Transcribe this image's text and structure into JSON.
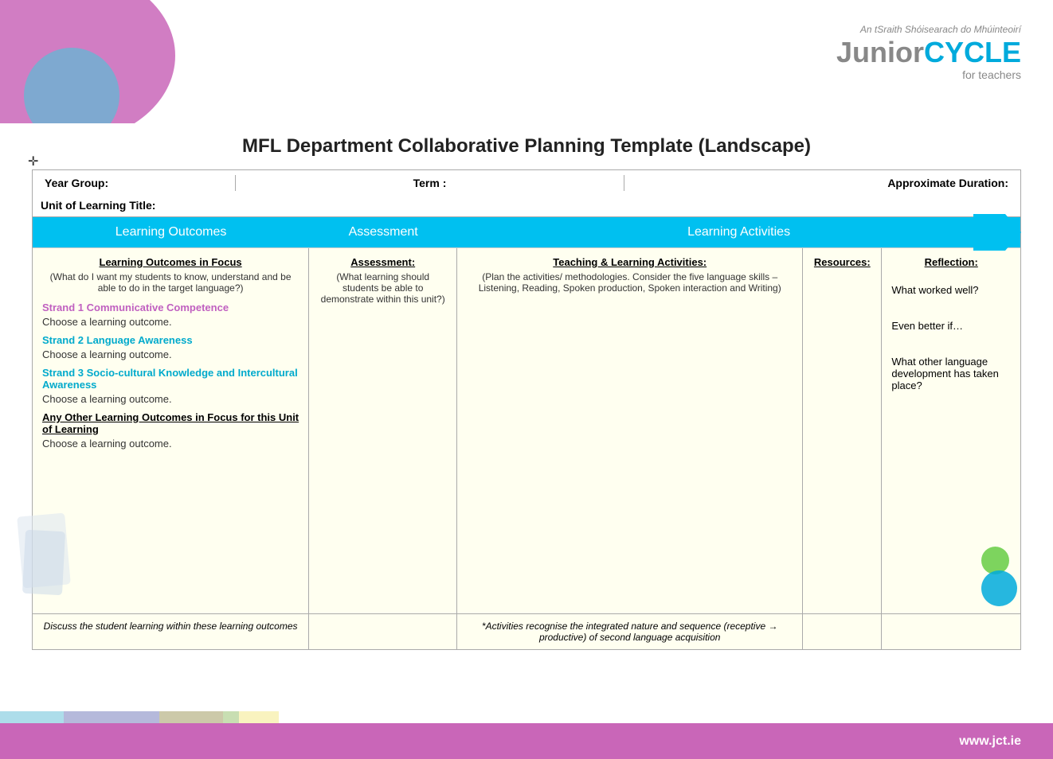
{
  "header": {
    "logo_subtitle": "An tSraith Shóisearach do Mhúinteoirí",
    "logo_junior": "Junior",
    "logo_cycle": "CYCLE",
    "logo_tagline": "for teachers"
  },
  "page": {
    "title": "MFL Department Collaborative Planning Template (Landscape)"
  },
  "meta": {
    "year_group_label": "Year Group:",
    "term_label": "Term :",
    "approx_duration_label": "Approximate Duration:",
    "unit_label": "Unit of Learning Title:"
  },
  "blue_header": {
    "col1": "Learning Outcomes",
    "col2": "Assessment",
    "col3": "Learning Activities"
  },
  "columns": {
    "lo_header": "Learning Outcomes in Focus",
    "lo_subtext": "(What do I want my students to know, understand and be able to do in the target language?)",
    "assessment_header": "Assessment:",
    "assessment_subtext": "(What learning should students be able to demonstrate within this unit?)",
    "activities_header": "Teaching & Learning Activities:",
    "activities_subtext": "(Plan the activities/ methodologies. Consider the five language skills – Listening, Reading, Spoken production, Spoken interaction and Writing)",
    "resources_header": "Resources:",
    "reflection_header": "Reflection:"
  },
  "strands": {
    "strand1": "Strand 1 Communicative Competence",
    "strand1_choose": "Choose a learning outcome.",
    "strand2": "Strand 2 Language Awareness",
    "strand2_choose": "Choose a learning outcome.",
    "strand3": "Strand 3 Socio-cultural Knowledge and Intercultural Awareness",
    "strand3_choose": "Choose a learning outcome.",
    "other_outcomes": "Any Other Learning Outcomes in Focus for this Unit of Learning",
    "other_choose": "Choose a learning outcome."
  },
  "reflection": {
    "what_worked": "What worked well?",
    "even_better": "Even better if…",
    "other_language": "What other language development has taken place?"
  },
  "footer": {
    "lo_text": "Discuss the student learning within these learning outcomes",
    "activities_text": "*Activities recognise the integrated nature and sequence (receptive → productive) of second language acquisition"
  },
  "bottom_bar": {
    "url": "www.jct.ie"
  }
}
